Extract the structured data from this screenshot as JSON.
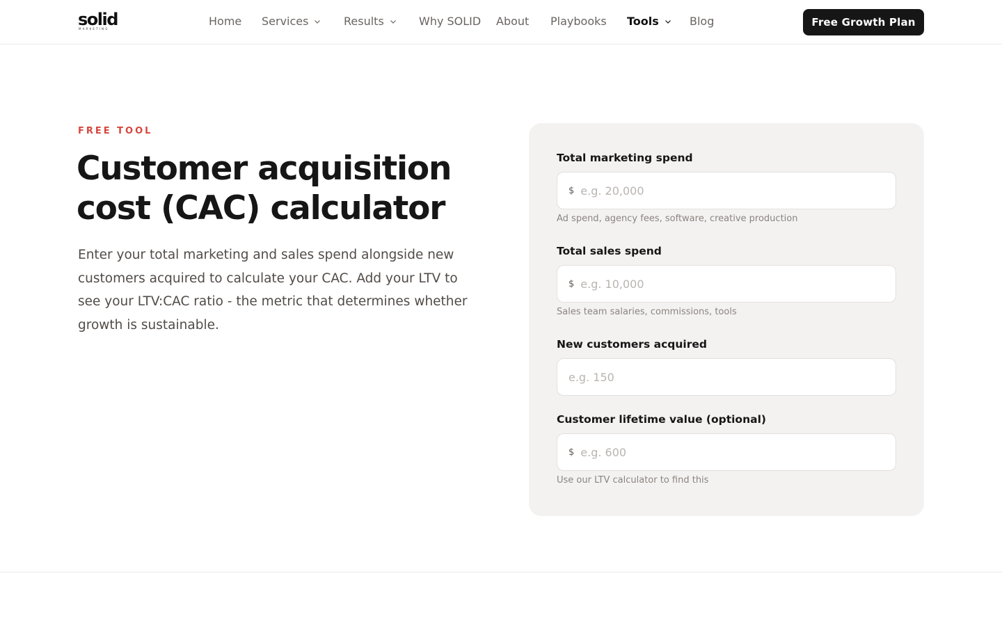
{
  "header": {
    "logo": {
      "wordmark": "solid",
      "tagline": "MARKETING"
    },
    "nav": [
      {
        "label": "Home",
        "dropdown": false
      },
      {
        "label": "Services",
        "dropdown": true
      },
      {
        "label": "Results",
        "dropdown": true
      },
      {
        "label": "Why SOLID",
        "dropdown": false
      },
      {
        "label": "About",
        "dropdown": false
      },
      {
        "label": "Playbooks",
        "dropdown": false
      },
      {
        "label": "Tools",
        "dropdown": true,
        "active": true
      },
      {
        "label": "Blog",
        "dropdown": false
      }
    ],
    "cta_label": "Free Growth Plan"
  },
  "hero": {
    "eyebrow": "FREE TOOL",
    "title_line1": "Customer acquisition",
    "title_line2": "cost (CAC) calculator",
    "description": "Enter your total marketing and sales spend alongside new customers acquired to calculate your CAC. Add your LTV to see your LTV:CAC ratio - the metric that determines whether growth is sustainable."
  },
  "calculator": {
    "fields": [
      {
        "label": "Total marketing spend",
        "prefix": "$",
        "placeholder": "e.g. 20,000",
        "hint": "Ad spend, agency fees, software, creative production"
      },
      {
        "label": "Total sales spend",
        "prefix": "$",
        "placeholder": "e.g. 10,000",
        "hint": "Sales team salaries, commissions, tools"
      },
      {
        "label": "New customers acquired",
        "prefix": "",
        "placeholder": "e.g. 150",
        "hint": ""
      },
      {
        "label": "Customer lifetime value (optional)",
        "prefix": "$",
        "placeholder": "e.g. 600",
        "hint": "Use our LTV calculator to find this"
      }
    ]
  },
  "colors": {
    "accent": "#d6463e",
    "cta_bg": "#161616",
    "card_bg": "#f4f2f1"
  }
}
